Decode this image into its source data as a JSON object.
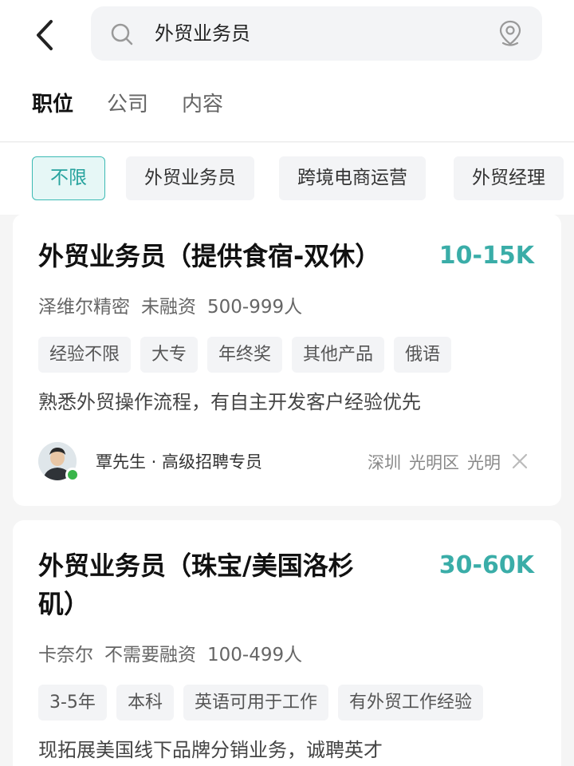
{
  "search": {
    "query": "外贸业务员"
  },
  "tabs": [
    {
      "label": "职位"
    },
    {
      "label": "公司"
    },
    {
      "label": "内容"
    }
  ],
  "filters": [
    {
      "label": "不限"
    },
    {
      "label": "外贸业务员"
    },
    {
      "label": "跨境电商运营"
    },
    {
      "label": "外贸经理"
    }
  ],
  "jobs": [
    {
      "title": "外贸业务员（提供食宿-双休）",
      "salary": "10-15K",
      "company": "泽维尔精密",
      "funding": "未融资",
      "size": "500-999人",
      "tags": [
        "经验不限",
        "大专",
        "年终奖",
        "其他产品",
        "俄语"
      ],
      "description": "熟悉外贸操作流程，有自主开发客户经验优先",
      "recruiter": "覃先生 · 高级招聘专员",
      "location": {
        "city": "深圳",
        "district": "光明区",
        "area": "光明"
      }
    },
    {
      "title_line1": "外贸业务员（珠宝/美国洛杉",
      "title_line2": "矶）",
      "salary": "30-60K",
      "company": "卡奈尔",
      "funding": "不需要融资",
      "size": "100-499人",
      "tags": [
        "3-5年",
        "本科",
        "英语可用于工作",
        "有外贸工作经验"
      ],
      "description": "现拓展美国线下品牌分销业务，诚聘英才"
    }
  ],
  "colors": {
    "accent": "#3aada8",
    "chip_active_bg": "#e6f7f6",
    "online": "#39b54a"
  }
}
